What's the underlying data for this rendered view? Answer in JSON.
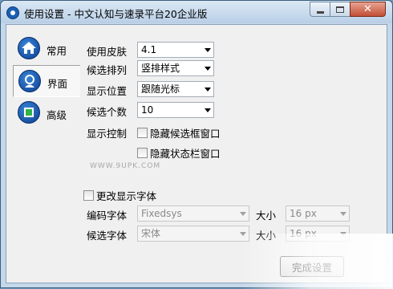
{
  "window": {
    "title": "使用设置 - 中文认知与速录平台20企业版",
    "close_glyph": "✕"
  },
  "sidebar": {
    "items": [
      {
        "label": "常用",
        "icon": "home-icon",
        "selected": false
      },
      {
        "label": "界面",
        "icon": "person-icon",
        "selected": true
      },
      {
        "label": "高级",
        "icon": "square-icon",
        "selected": false
      }
    ]
  },
  "settings": {
    "skin": {
      "label": "使用皮肤",
      "value": "4.1"
    },
    "order": {
      "label": "候选排列",
      "value": "竖排样式"
    },
    "position": {
      "label": "显示位置",
      "value": "跟随光标"
    },
    "count": {
      "label": "候选个数",
      "value": "10"
    },
    "display_control": {
      "label": "显示控制",
      "hide_candidate_window": {
        "label": "隐藏候选框窗口",
        "checked": false
      },
      "hide_status_bar": {
        "label": "隐藏状态栏窗口",
        "checked": false
      }
    }
  },
  "watermark": "WWW.9UPK.COM",
  "font": {
    "change_font": {
      "label": "更改显示字体",
      "checked": false
    },
    "encode": {
      "label": "编码字体",
      "font_value": "Fixedsys",
      "size_label": "大小",
      "size_value": "16 px"
    },
    "candidate": {
      "label": "候选字体",
      "font_value": "宋体",
      "size_label": "大小",
      "size_value": "16 px"
    }
  },
  "footer": {
    "reset_label": "完成设置"
  },
  "colors": {
    "accent": "#0a3d8f",
    "window_frame": "#c5d8ea",
    "close_button": "#c24e36"
  }
}
